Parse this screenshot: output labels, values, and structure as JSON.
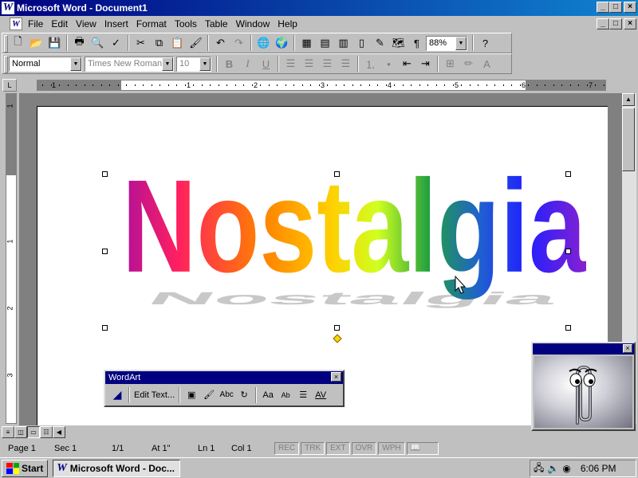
{
  "window": {
    "title": "Microsoft Word - Document1",
    "app_icon": "W",
    "controls": {
      "minimize": "_",
      "maximize": "□",
      "close": "×"
    }
  },
  "menu": {
    "items": [
      "File",
      "Edit",
      "View",
      "Insert",
      "Format",
      "Tools",
      "Table",
      "Window",
      "Help"
    ],
    "doc_icon": "W"
  },
  "toolbar_standard": {
    "icons": [
      "new-icon",
      "open-icon",
      "save-icon",
      "print-icon",
      "print-preview-icon",
      "spelling-icon",
      "cut-icon",
      "copy-icon",
      "paste-icon",
      "format-painter-icon",
      "undo-icon",
      "redo-icon",
      "hyperlink-icon",
      "web-toolbar-icon",
      "tables-borders-icon",
      "insert-table-icon",
      "insert-excel-icon",
      "columns-icon",
      "drawing-icon",
      "document-map-icon",
      "show-hide-icon",
      "help-icon"
    ],
    "zoom": "88%"
  },
  "toolbar_formatting": {
    "style": "Normal",
    "font": "Times New Roman",
    "size": "10",
    "bold": "B",
    "italic": "I",
    "underline": "U"
  },
  "ruler": {
    "numbers": [
      "1",
      "1",
      "2",
      "3",
      "4",
      "5",
      "6",
      "7"
    ],
    "vertical_numbers": [
      "1",
      "1",
      "2",
      "3"
    ],
    "tab_selector": "L"
  },
  "wordart": {
    "text": "Nostalgia",
    "colors": [
      "#b0109a",
      "#ff2060",
      "#ff8000",
      "#ffd000",
      "#d0ff20",
      "#20a040",
      "#2060d0",
      "#2020ff",
      "#8a20d0"
    ],
    "shadow_color": "#c8c8c8"
  },
  "wordart_toolbar": {
    "title": "WordArt",
    "edit_text_label": "Edit Text...",
    "close": "×",
    "icons": [
      "insert-wordart-icon",
      "edit-text-icon",
      "wordart-gallery-icon",
      "format-wordart-icon",
      "wordart-shape-icon",
      "free-rotate-icon",
      "same-letter-heights-icon",
      "vertical-text-icon",
      "alignment-icon",
      "character-spacing-icon"
    ]
  },
  "statusbar": {
    "page": "Page 1",
    "sec": "Sec 1",
    "pages": "1/1",
    "at": "At 1\"",
    "ln": "Ln 1",
    "col": "Col 1",
    "modes": [
      "REC",
      "TRK",
      "EXT",
      "OVR",
      "WPH"
    ]
  },
  "taskbar": {
    "start": "Start",
    "task": "Microsoft Word - Doc...",
    "time": "6:06 PM"
  },
  "assistant": {
    "close": "×",
    "character": "paperclip"
  }
}
